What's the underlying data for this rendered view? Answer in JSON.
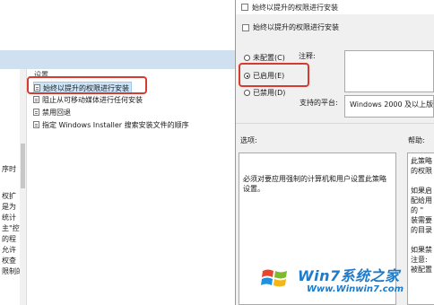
{
  "background_window": {
    "settings_header": "设置",
    "policies": [
      "始终以提升的权限进行安装",
      "阻止从可移动媒体进行任何安装",
      "禁用回退",
      "指定 Windows Installer 搜索安装文件的顺序"
    ],
    "left_snippets": [
      "序时",
      "权扩",
      "是为",
      "统计",
      "主\"控",
      "的程",
      "允许",
      "权查",
      "限制的"
    ]
  },
  "dialog": {
    "title": "始终以提升的权限进行安装",
    "heading": "始终以提升的权限进行安装",
    "radio_options": [
      {
        "label": "未配置(C)",
        "checked": false
      },
      {
        "label": "已启用(E)",
        "checked": true
      },
      {
        "label": "已禁用(D)",
        "checked": false
      }
    ],
    "comment_label": "注释:",
    "platform_label": "支持的平台:",
    "platform_value": "Windows 2000 及以上版本",
    "options_label": "选项:",
    "help_label": "帮助:",
    "options_text": "必须对要应用强制的计算机和用户设置此策略设置。",
    "help_lines": [
      "此策略",
      "的权限",
      "",
      "如果启",
      "配给用",
      "的 \"",
      "装需要",
      "的目录",
      "",
      "如果禁",
      "注意:",
      "被配置"
    ]
  },
  "watermark": {
    "brand": "Win7系统之家",
    "url": "Www.Winwin7.com"
  },
  "colors": {
    "highlight": "#d63b2f",
    "selection": "#cce4f7",
    "watermark_blue": "#1f7ac7"
  }
}
